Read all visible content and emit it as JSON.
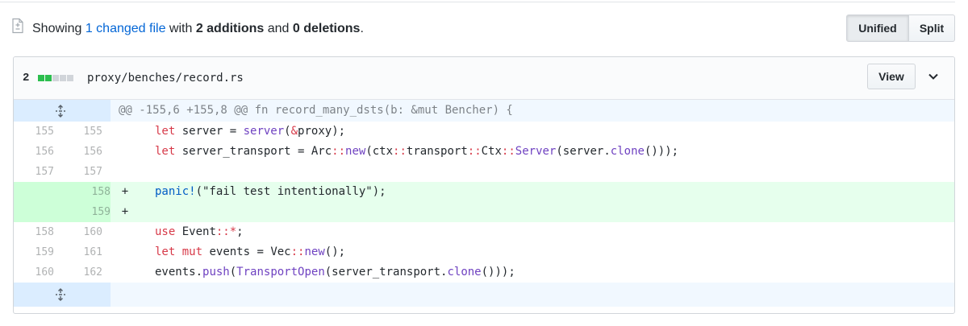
{
  "summary": {
    "prefix": "Showing ",
    "changed_files_link": "1 changed file",
    "mid1": " with ",
    "additions": "2 additions",
    "mid2": " and ",
    "deletions": "0 deletions",
    "suffix": "."
  },
  "view_toggle": {
    "unified_label": "Unified",
    "split_label": "Split",
    "selected": "Unified"
  },
  "file": {
    "change_count": "2",
    "diffstat_blocks": [
      "added",
      "added",
      "neutral",
      "neutral",
      "neutral"
    ],
    "path": "proxy/benches/record.rs",
    "view_label": "View"
  },
  "colors": {
    "added_block": "#2cbe4e",
    "neutral_block": "#d1d5da",
    "link": "#0366d6",
    "addition_bg": "#e6ffed",
    "addition_gutter_bg": "#cdffd8",
    "hunk_bg": "#f1f8ff",
    "keyword": "#d73a49",
    "function": "#6f42c1",
    "macro": "#005cc5"
  },
  "hunk_header": "@@ -155,6 +155,8 @@ fn record_many_dsts(b: &mut Bencher) {",
  "lines": [
    {
      "old": "155",
      "new": "155",
      "marker": "",
      "type": "context"
    },
    {
      "old": "156",
      "new": "156",
      "marker": "",
      "type": "context"
    },
    {
      "old": "157",
      "new": "157",
      "marker": "",
      "type": "context"
    },
    {
      "old": "",
      "new": "158",
      "marker": "+",
      "type": "add"
    },
    {
      "old": "",
      "new": "159",
      "marker": "+",
      "type": "add"
    },
    {
      "old": "158",
      "new": "160",
      "marker": "",
      "type": "context"
    },
    {
      "old": "159",
      "new": "161",
      "marker": "",
      "type": "context"
    },
    {
      "old": "160",
      "new": "162",
      "marker": "",
      "type": "context"
    }
  ],
  "code": {
    "l0": {
      "kw": "let",
      "a": " server = ",
      "fn": "server",
      "b": "(",
      "op": "&",
      "c": "proxy);"
    },
    "l1": {
      "kw": "let",
      "a": " server_transport = Arc",
      "op1": "::",
      "fn1": "new",
      "b": "(ctx",
      "op2": "::",
      "c": "transport",
      "op3": "::",
      "d": "Ctx",
      "op4": "::",
      "fn2": "Server",
      "e": "(server.",
      "fn3": "clone",
      "f": "()));"
    },
    "l2": {
      "text": ""
    },
    "l3": {
      "mac": "panic!",
      "a": "(\"fail test intentionally\");"
    },
    "l4": {
      "text": ""
    },
    "l5": {
      "kw": "use",
      "a": " Event",
      "op": "::*",
      "b": ";"
    },
    "l6": {
      "kw1": "let",
      "sp": " ",
      "kw2": "mut",
      "a": " events = Vec",
      "op": "::",
      "fn": "new",
      "b": "();"
    },
    "l7": {
      "a": "events.",
      "fn1": "push",
      "b": "(",
      "fn2": "TransportOpen",
      "c": "(server_transport.",
      "fn3": "clone",
      "d": "()));"
    }
  }
}
